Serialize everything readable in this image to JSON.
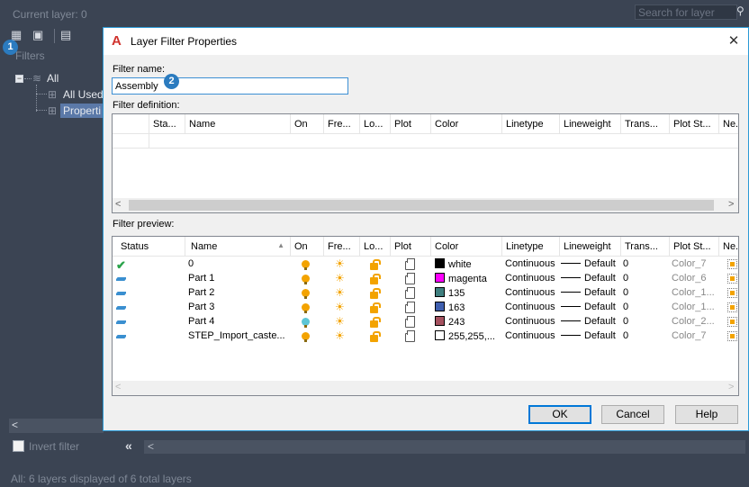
{
  "background": {
    "title": "Current layer: 0",
    "search_placeholder": "Search for layer",
    "filters_label": "Filters",
    "tree": {
      "root": "All",
      "child1": "All Used",
      "child2": "Properti"
    },
    "invert_filter_label": "Invert filter",
    "collapse_glyph": "«",
    "status_text": "All: 6 layers displayed of 6 total layers"
  },
  "callouts": [
    "1",
    "2"
  ],
  "dialog": {
    "title": "Layer Filter Properties",
    "close_glyph": "✕",
    "filter_name_label": "Filter name:",
    "filter_name_value": "Assembly",
    "filter_definition_label": "Filter definition:",
    "filter_preview_label": "Filter preview:",
    "definition_columns": [
      "Sta...",
      "Name",
      "On",
      "Fre...",
      "Lo...",
      "Plot",
      "Color",
      "Linetype",
      "Lineweight",
      "Trans...",
      "Plot St...",
      "Ne."
    ],
    "preview_columns": [
      "Status",
      "Name",
      "On",
      "Fre...",
      "Lo...",
      "Plot",
      "Color",
      "Linetype",
      "Lineweight",
      "Trans...",
      "Plot St...",
      "Ne."
    ],
    "sort_indicator": "▲",
    "rows": [
      {
        "status": "current",
        "name": "0",
        "on": "on",
        "color_name": "white",
        "color_hex": "#000000",
        "linetype": "Continuous",
        "lineweight": "Default",
        "trans": "0",
        "plotstyle": "Color_7"
      },
      {
        "status": "layer",
        "name": "Part 1",
        "on": "on",
        "color_name": "magenta",
        "color_hex": "#ff00ff",
        "linetype": "Continuous",
        "lineweight": "Default",
        "trans": "0",
        "plotstyle": "Color_6"
      },
      {
        "status": "layer",
        "name": "Part 2",
        "on": "on",
        "color_name": "135",
        "color_hex": "#3f7f7f",
        "linetype": "Continuous",
        "lineweight": "Default",
        "trans": "0",
        "plotstyle": "Color_1..."
      },
      {
        "status": "layer",
        "name": "Part 3",
        "on": "on",
        "color_name": "163",
        "color_hex": "#3f5faf",
        "linetype": "Continuous",
        "lineweight": "Default",
        "trans": "0",
        "plotstyle": "Color_1..."
      },
      {
        "status": "layer",
        "name": "Part 4",
        "on": "blue",
        "color_name": "243",
        "color_hex": "#a5515f",
        "linetype": "Continuous",
        "lineweight": "Default",
        "trans": "0",
        "plotstyle": "Color_2..."
      },
      {
        "status": "layer",
        "name": "STEP_Import_caste...",
        "on": "on",
        "color_name": "255,255,...",
        "color_hex": "#ffffff",
        "linetype": "Continuous",
        "lineweight": "Default",
        "trans": "0",
        "plotstyle": "Color_7"
      }
    ],
    "buttons": {
      "ok": "OK",
      "cancel": "Cancel",
      "help": "Help"
    },
    "scroll_left": "<",
    "scroll_right": ">"
  }
}
